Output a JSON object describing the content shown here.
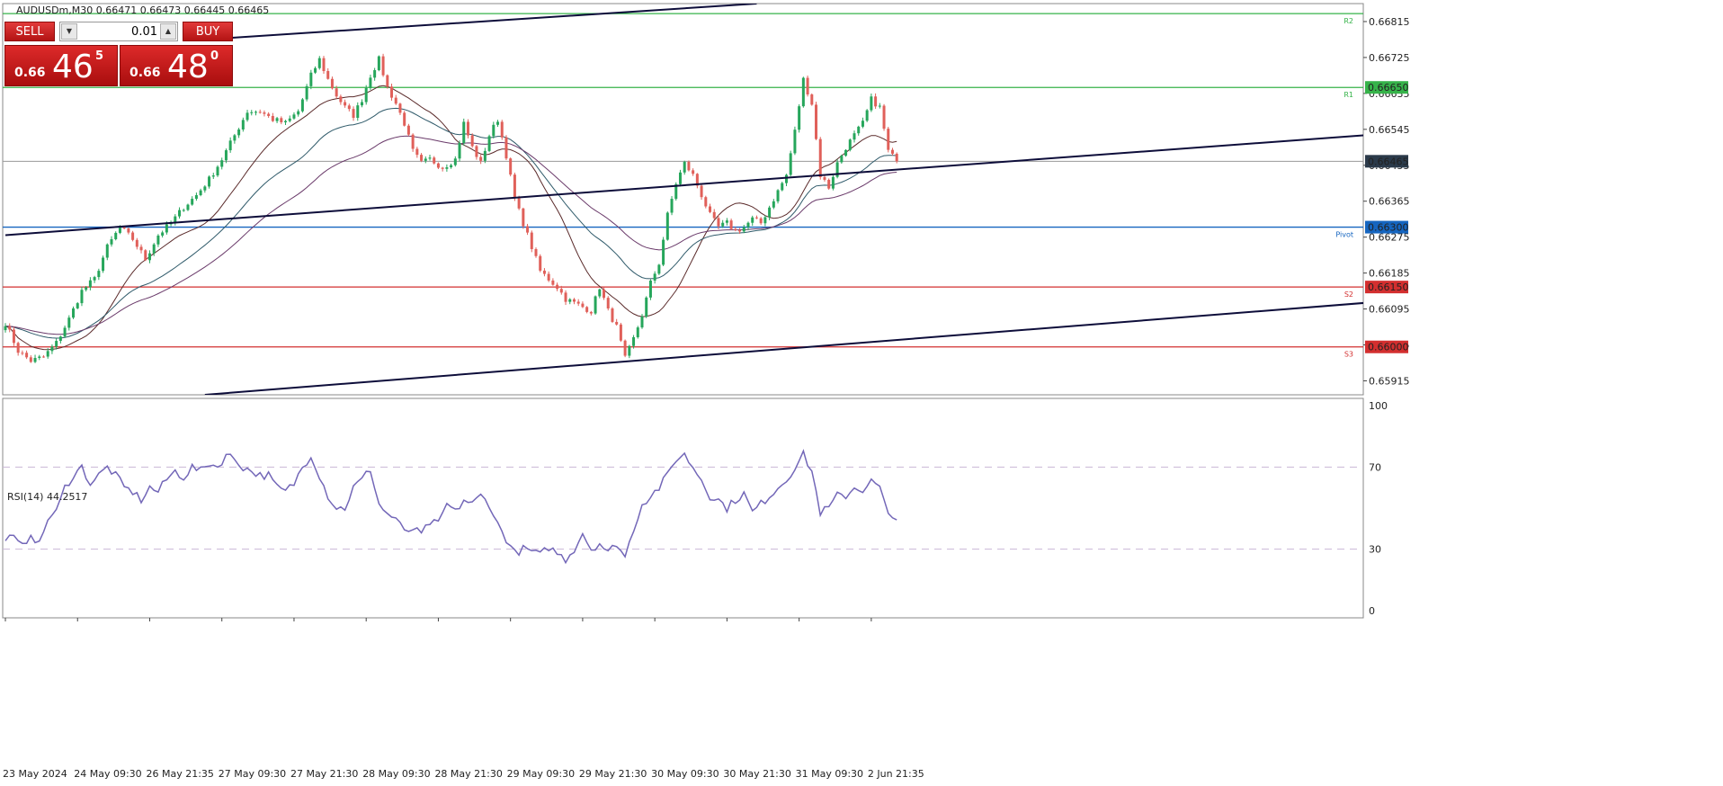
{
  "symbol_header": "AUDUSDm,M30  0.66471 0.66473 0.66445 0.66465",
  "trade_panel": {
    "sell_label": "SELL",
    "buy_label": "BUY",
    "lot": "0.01",
    "sell_base": "0.66",
    "sell_big": "46",
    "sell_sup": "5",
    "buy_base": "0.66",
    "buy_big": "48",
    "buy_sup": "0",
    "down_arrow_icon": "triangle-down-icon",
    "up_arrow_icon": "triangle-up-icon"
  },
  "colors": {
    "bull": "#26a65b",
    "bear": "#e0605a",
    "r1_line": "#36b34a",
    "pivot_line": "#1565c0",
    "support_line": "#d32f2f",
    "trendline": "#0d0d3a",
    "rsi_line": "#7367b8",
    "current_price_label": "#2b3a4a"
  },
  "chart_data": [
    {
      "type": "candlestick",
      "instrument": "AUDUSDm",
      "timeframe": "M30",
      "ylim": [
        0.6588,
        0.6686
      ],
      "y_ticks": [
        "0.66815",
        "0.66725",
        "0.66635",
        "0.66545",
        "0.66455",
        "0.66365",
        "0.66275",
        "0.66185",
        "0.66095",
        "0.66005",
        "0.65915"
      ],
      "x_labels": [
        {
          "i": 0,
          "label": "23 May 2024"
        },
        {
          "i": 17,
          "label": "24 May 09:30"
        },
        {
          "i": 34,
          "label": "26 May 21:35"
        },
        {
          "i": 51,
          "label": "27 May 09:30"
        },
        {
          "i": 68,
          "label": "27 May 21:30"
        },
        {
          "i": 85,
          "label": "28 May 09:30"
        },
        {
          "i": 102,
          "label": "28 May 21:30"
        },
        {
          "i": 119,
          "label": "29 May 09:30"
        },
        {
          "i": 136,
          "label": "29 May 21:30"
        },
        {
          "i": 153,
          "label": "30 May 09:30"
        },
        {
          "i": 170,
          "label": "30 May 21:30"
        },
        {
          "i": 187,
          "label": "31 May 09:30"
        },
        {
          "i": 204,
          "label": "2 Jun 21:35"
        }
      ],
      "close_keypoints": [
        [
          0,
          0.6606
        ],
        [
          3,
          0.6599
        ],
        [
          6,
          0.65965
        ],
        [
          9,
          0.65975
        ],
        [
          12,
          0.6601
        ],
        [
          15,
          0.6607
        ],
        [
          18,
          0.6614
        ],
        [
          21,
          0.6617
        ],
        [
          24,
          0.6625
        ],
        [
          27,
          0.663
        ],
        [
          30,
          0.6627
        ],
        [
          33,
          0.6622
        ],
        [
          36,
          0.6628
        ],
        [
          39,
          0.6631
        ],
        [
          42,
          0.6635
        ],
        [
          45,
          0.6638
        ],
        [
          48,
          0.6642
        ],
        [
          51,
          0.6647
        ],
        [
          54,
          0.6653
        ],
        [
          57,
          0.6659
        ],
        [
          60,
          0.6659
        ],
        [
          63,
          0.6657
        ],
        [
          66,
          0.6656
        ],
        [
          69,
          0.6659
        ],
        [
          72,
          0.6668
        ],
        [
          74,
          0.6672
        ],
        [
          76,
          0.6667
        ],
        [
          78,
          0.6663
        ],
        [
          80,
          0.666
        ],
        [
          82,
          0.6658
        ],
        [
          84,
          0.6662
        ],
        [
          86,
          0.6668
        ],
        [
          88,
          0.6672
        ],
        [
          90,
          0.6665
        ],
        [
          92,
          0.6661
        ],
        [
          94,
          0.6656
        ],
        [
          96,
          0.6649
        ],
        [
          98,
          0.6646
        ],
        [
          100,
          0.6647
        ],
        [
          103,
          0.6645
        ],
        [
          106,
          0.6647
        ],
        [
          108,
          0.6656
        ],
        [
          110,
          0.665
        ],
        [
          112,
          0.6646
        ],
        [
          114,
          0.6653
        ],
        [
          116,
          0.6657
        ],
        [
          118,
          0.6648
        ],
        [
          120,
          0.6637
        ],
        [
          122,
          0.6631
        ],
        [
          124,
          0.6625
        ],
        [
          126,
          0.6619
        ],
        [
          128,
          0.6617
        ],
        [
          130,
          0.6615
        ],
        [
          132,
          0.6612
        ],
        [
          134,
          0.6611
        ],
        [
          136,
          0.661
        ],
        [
          138,
          0.6609
        ],
        [
          140,
          0.6615
        ],
        [
          142,
          0.6609
        ],
        [
          144,
          0.6605
        ],
        [
          146,
          0.6597
        ],
        [
          148,
          0.6602
        ],
        [
          150,
          0.6608
        ],
        [
          152,
          0.6616
        ],
        [
          154,
          0.6621
        ],
        [
          156,
          0.6633
        ],
        [
          158,
          0.6641
        ],
        [
          160,
          0.6646
        ],
        [
          162,
          0.6643
        ],
        [
          164,
          0.6638
        ],
        [
          166,
          0.6633
        ],
        [
          168,
          0.663
        ],
        [
          170,
          0.6631
        ],
        [
          172,
          0.6629
        ],
        [
          174,
          0.663
        ],
        [
          176,
          0.6632
        ],
        [
          178,
          0.6631
        ],
        [
          180,
          0.6635
        ],
        [
          182,
          0.6639
        ],
        [
          184,
          0.6643
        ],
        [
          186,
          0.6654
        ],
        [
          188,
          0.6667
        ],
        [
          190,
          0.6661
        ],
        [
          192,
          0.6643
        ],
        [
          194,
          0.664
        ],
        [
          196,
          0.6646
        ],
        [
          198,
          0.665
        ],
        [
          200,
          0.6653
        ],
        [
          202,
          0.6656
        ],
        [
          204,
          0.6662
        ],
        [
          206,
          0.666
        ],
        [
          208,
          0.6649
        ],
        [
          210,
          0.66465
        ]
      ],
      "levels": [
        {
          "name": "R2",
          "value": 0.66835,
          "color": "#36b34a",
          "label": "R2",
          "price_tag": ""
        },
        {
          "name": "R1",
          "value": 0.6665,
          "color": "#36b34a",
          "label": "R1",
          "price_tag": "0.66650"
        },
        {
          "name": "Pivot",
          "value": 0.663,
          "color": "#1565c0",
          "label": "Pivot",
          "price_tag": "0.66300"
        },
        {
          "name": "S2",
          "value": 0.6615,
          "color": "#d32f2f",
          "label": "S2",
          "price_tag": "0.66150"
        },
        {
          "name": "S3",
          "value": 0.66,
          "color": "#d32f2f",
          "label": "S3",
          "price_tag": "0.66000"
        }
      ],
      "current_price": {
        "value": 0.66465,
        "label": "0.66465"
      },
      "trendlines": [
        {
          "from": [
            47,
            0.6677
          ],
          "to": [
            177,
            0.6686
          ]
        },
        {
          "from": [
            0,
            0.6628
          ],
          "to": [
            320,
            0.6653
          ]
        },
        {
          "from": [
            47,
            0.6588
          ],
          "to": [
            320,
            0.6611
          ]
        }
      ]
    },
    {
      "type": "line",
      "indicator": "RSI(14)",
      "title": "RSI(14) 44.2517",
      "value": 44.2517,
      "ylim": [
        0,
        100
      ],
      "y_ticks": [
        "100",
        "70",
        "30",
        "0"
      ],
      "levels": [
        70,
        30
      ],
      "keypoints": [
        [
          0,
          36
        ],
        [
          2,
          35
        ],
        [
          4,
          31
        ],
        [
          6,
          38
        ],
        [
          8,
          32
        ],
        [
          10,
          45
        ],
        [
          12,
          48
        ],
        [
          14,
          60
        ],
        [
          16,
          66
        ],
        [
          18,
          70
        ],
        [
          20,
          62
        ],
        [
          22,
          66
        ],
        [
          24,
          70
        ],
        [
          26,
          66
        ],
        [
          28,
          60
        ],
        [
          30,
          58
        ],
        [
          32,
          54
        ],
        [
          34,
          60
        ],
        [
          36,
          58
        ],
        [
          38,
          64
        ],
        [
          40,
          68
        ],
        [
          42,
          65
        ],
        [
          44,
          70
        ],
        [
          46,
          68
        ],
        [
          48,
          72
        ],
        [
          50,
          70
        ],
        [
          52,
          76
        ],
        [
          54,
          74
        ],
        [
          56,
          70
        ],
        [
          58,
          68
        ],
        [
          60,
          66
        ],
        [
          62,
          66
        ],
        [
          64,
          60
        ],
        [
          66,
          58
        ],
        [
          68,
          62
        ],
        [
          70,
          70
        ],
        [
          72,
          76
        ],
        [
          74,
          66
        ],
        [
          76,
          56
        ],
        [
          78,
          50
        ],
        [
          80,
          50
        ],
        [
          82,
          60
        ],
        [
          84,
          64
        ],
        [
          86,
          69
        ],
        [
          88,
          52
        ],
        [
          90,
          47
        ],
        [
          92,
          45
        ],
        [
          94,
          38
        ],
        [
          96,
          40
        ],
        [
          98,
          37
        ],
        [
          100,
          43
        ],
        [
          102,
          42
        ],
        [
          104,
          52
        ],
        [
          106,
          48
        ],
        [
          108,
          54
        ],
        [
          110,
          52
        ],
        [
          112,
          56
        ],
        [
          114,
          52
        ],
        [
          116,
          42
        ],
        [
          118,
          35
        ],
        [
          120,
          28
        ],
        [
          122,
          30
        ],
        [
          124,
          29
        ],
        [
          126,
          27
        ],
        [
          128,
          31
        ],
        [
          130,
          28
        ],
        [
          132,
          25
        ],
        [
          134,
          30
        ],
        [
          136,
          38
        ],
        [
          138,
          30
        ],
        [
          140,
          33
        ],
        [
          142,
          28
        ],
        [
          144,
          33
        ],
        [
          146,
          26
        ],
        [
          148,
          40
        ],
        [
          150,
          52
        ],
        [
          152,
          56
        ],
        [
          154,
          60
        ],
        [
          156,
          66
        ],
        [
          158,
          74
        ],
        [
          160,
          76
        ],
        [
          162,
          70
        ],
        [
          164,
          64
        ],
        [
          166,
          56
        ],
        [
          168,
          54
        ],
        [
          170,
          50
        ],
        [
          172,
          54
        ],
        [
          174,
          57
        ],
        [
          176,
          48
        ],
        [
          178,
          52
        ],
        [
          180,
          56
        ],
        [
          182,
          60
        ],
        [
          184,
          64
        ],
        [
          186,
          70
        ],
        [
          188,
          76
        ],
        [
          190,
          68
        ],
        [
          192,
          48
        ],
        [
          194,
          50
        ],
        [
          196,
          56
        ],
        [
          198,
          56
        ],
        [
          200,
          60
        ],
        [
          202,
          59
        ],
        [
          204,
          63
        ],
        [
          206,
          60
        ],
        [
          208,
          46
        ],
        [
          210,
          44.25
        ]
      ]
    }
  ]
}
